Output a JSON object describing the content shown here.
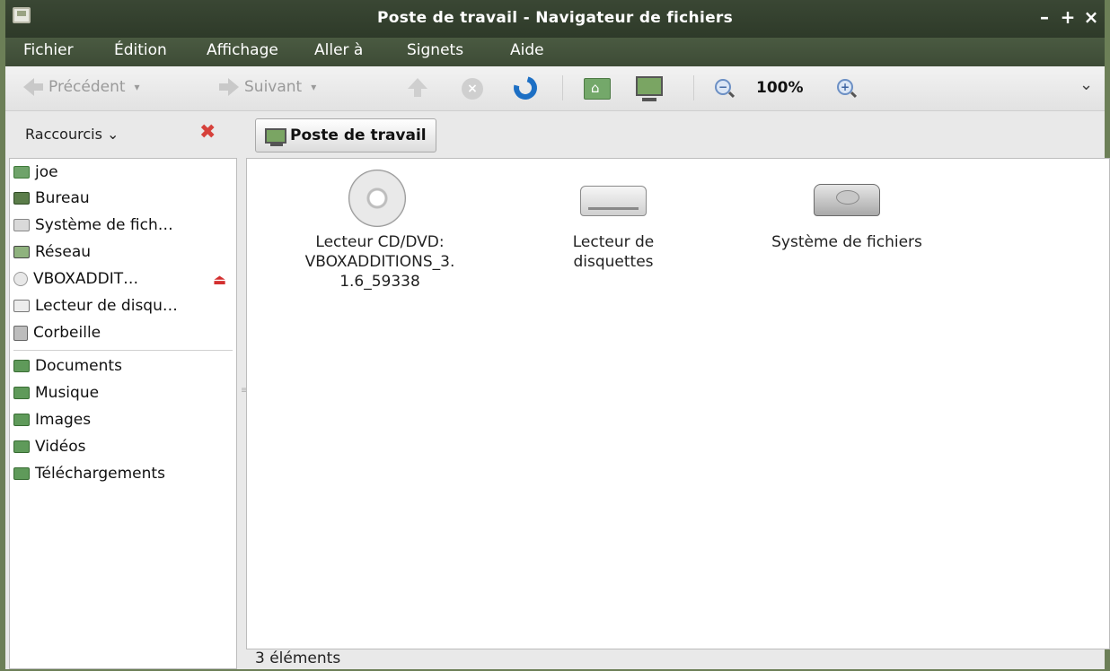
{
  "window": {
    "title": "Poste de travail - Navigateur de fichiers",
    "minimize": "–",
    "maximize": "+",
    "close": "×"
  },
  "menu": [
    "Fichier",
    "Édition",
    "Affichage",
    "Aller à",
    "Signets",
    "Aide"
  ],
  "toolbar": {
    "back_label": "Précédent",
    "forward_label": "Suivant",
    "zoom_value": "100%",
    "overflow": "⌄"
  },
  "locationbar": {
    "shortcuts_label": "Raccourcis",
    "shortcuts_chevron": "⌄",
    "close_symbol": "✖",
    "path_button": "Poste de travail"
  },
  "sidebar": {
    "places": [
      {
        "label": "joe",
        "icon": "home-folder-icon"
      },
      {
        "label": "Bureau",
        "icon": "desktop-icon"
      },
      {
        "label": "Système de fich…",
        "icon": "filesystem-icon"
      },
      {
        "label": "Réseau",
        "icon": "network-icon"
      },
      {
        "label": "VBOXADDIT…",
        "icon": "cdrom-icon"
      },
      {
        "label": "Lecteur de disqu…",
        "icon": "floppy-icon"
      },
      {
        "label": "Corbeille",
        "icon": "trash-icon"
      }
    ],
    "bookmarks": [
      {
        "label": "Documents",
        "icon": "documents-folder-icon"
      },
      {
        "label": "Musique",
        "icon": "music-folder-icon"
      },
      {
        "label": "Images",
        "icon": "pictures-folder-icon"
      },
      {
        "label": "Vidéos",
        "icon": "videos-folder-icon"
      },
      {
        "label": "Téléchargements",
        "icon": "downloads-folder-icon"
      }
    ],
    "eject_symbol": "⏏"
  },
  "main": {
    "items": [
      {
        "label_line1": "Lecteur CD/DVD:",
        "label_line2": "VBOXADDITIONS_3.",
        "label_line3": "1.6_59338",
        "icon": "cdrom-drive-icon"
      },
      {
        "label_line1": "Lecteur de",
        "label_line2": "disquettes",
        "icon": "floppy-drive-icon"
      },
      {
        "label_line1": "Système de fichiers",
        "icon": "harddisk-icon"
      }
    ]
  },
  "status": {
    "text": "3 éléments"
  },
  "colors": {
    "accent": "#1d6fc4",
    "titlebar": "#3a4734",
    "eject": "#d32f2f"
  }
}
